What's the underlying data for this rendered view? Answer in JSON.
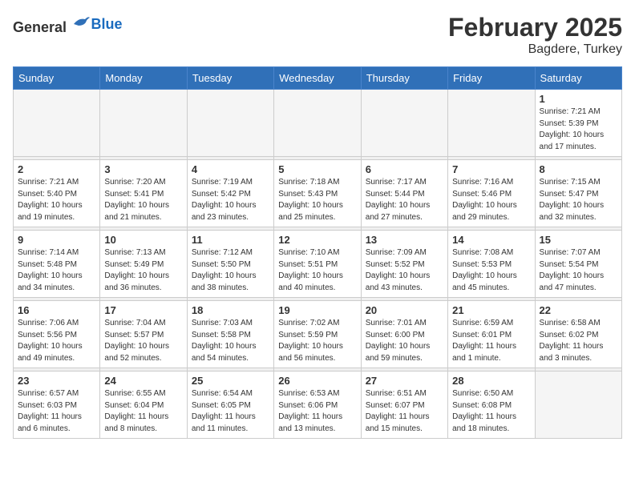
{
  "header": {
    "logo_general": "General",
    "logo_blue": "Blue",
    "month": "February 2025",
    "location": "Bagdere, Turkey"
  },
  "weekdays": [
    "Sunday",
    "Monday",
    "Tuesday",
    "Wednesday",
    "Thursday",
    "Friday",
    "Saturday"
  ],
  "weeks": [
    [
      {
        "day": "",
        "info": ""
      },
      {
        "day": "",
        "info": ""
      },
      {
        "day": "",
        "info": ""
      },
      {
        "day": "",
        "info": ""
      },
      {
        "day": "",
        "info": ""
      },
      {
        "day": "",
        "info": ""
      },
      {
        "day": "1",
        "info": "Sunrise: 7:21 AM\nSunset: 5:39 PM\nDaylight: 10 hours\nand 17 minutes."
      }
    ],
    [
      {
        "day": "2",
        "info": "Sunrise: 7:21 AM\nSunset: 5:40 PM\nDaylight: 10 hours\nand 19 minutes."
      },
      {
        "day": "3",
        "info": "Sunrise: 7:20 AM\nSunset: 5:41 PM\nDaylight: 10 hours\nand 21 minutes."
      },
      {
        "day": "4",
        "info": "Sunrise: 7:19 AM\nSunset: 5:42 PM\nDaylight: 10 hours\nand 23 minutes."
      },
      {
        "day": "5",
        "info": "Sunrise: 7:18 AM\nSunset: 5:43 PM\nDaylight: 10 hours\nand 25 minutes."
      },
      {
        "day": "6",
        "info": "Sunrise: 7:17 AM\nSunset: 5:44 PM\nDaylight: 10 hours\nand 27 minutes."
      },
      {
        "day": "7",
        "info": "Sunrise: 7:16 AM\nSunset: 5:46 PM\nDaylight: 10 hours\nand 29 minutes."
      },
      {
        "day": "8",
        "info": "Sunrise: 7:15 AM\nSunset: 5:47 PM\nDaylight: 10 hours\nand 32 minutes."
      }
    ],
    [
      {
        "day": "9",
        "info": "Sunrise: 7:14 AM\nSunset: 5:48 PM\nDaylight: 10 hours\nand 34 minutes."
      },
      {
        "day": "10",
        "info": "Sunrise: 7:13 AM\nSunset: 5:49 PM\nDaylight: 10 hours\nand 36 minutes."
      },
      {
        "day": "11",
        "info": "Sunrise: 7:12 AM\nSunset: 5:50 PM\nDaylight: 10 hours\nand 38 minutes."
      },
      {
        "day": "12",
        "info": "Sunrise: 7:10 AM\nSunset: 5:51 PM\nDaylight: 10 hours\nand 40 minutes."
      },
      {
        "day": "13",
        "info": "Sunrise: 7:09 AM\nSunset: 5:52 PM\nDaylight: 10 hours\nand 43 minutes."
      },
      {
        "day": "14",
        "info": "Sunrise: 7:08 AM\nSunset: 5:53 PM\nDaylight: 10 hours\nand 45 minutes."
      },
      {
        "day": "15",
        "info": "Sunrise: 7:07 AM\nSunset: 5:54 PM\nDaylight: 10 hours\nand 47 minutes."
      }
    ],
    [
      {
        "day": "16",
        "info": "Sunrise: 7:06 AM\nSunset: 5:56 PM\nDaylight: 10 hours\nand 49 minutes."
      },
      {
        "day": "17",
        "info": "Sunrise: 7:04 AM\nSunset: 5:57 PM\nDaylight: 10 hours\nand 52 minutes."
      },
      {
        "day": "18",
        "info": "Sunrise: 7:03 AM\nSunset: 5:58 PM\nDaylight: 10 hours\nand 54 minutes."
      },
      {
        "day": "19",
        "info": "Sunrise: 7:02 AM\nSunset: 5:59 PM\nDaylight: 10 hours\nand 56 minutes."
      },
      {
        "day": "20",
        "info": "Sunrise: 7:01 AM\nSunset: 6:00 PM\nDaylight: 10 hours\nand 59 minutes."
      },
      {
        "day": "21",
        "info": "Sunrise: 6:59 AM\nSunset: 6:01 PM\nDaylight: 11 hours\nand 1 minute."
      },
      {
        "day": "22",
        "info": "Sunrise: 6:58 AM\nSunset: 6:02 PM\nDaylight: 11 hours\nand 3 minutes."
      }
    ],
    [
      {
        "day": "23",
        "info": "Sunrise: 6:57 AM\nSunset: 6:03 PM\nDaylight: 11 hours\nand 6 minutes."
      },
      {
        "day": "24",
        "info": "Sunrise: 6:55 AM\nSunset: 6:04 PM\nDaylight: 11 hours\nand 8 minutes."
      },
      {
        "day": "25",
        "info": "Sunrise: 6:54 AM\nSunset: 6:05 PM\nDaylight: 11 hours\nand 11 minutes."
      },
      {
        "day": "26",
        "info": "Sunrise: 6:53 AM\nSunset: 6:06 PM\nDaylight: 11 hours\nand 13 minutes."
      },
      {
        "day": "27",
        "info": "Sunrise: 6:51 AM\nSunset: 6:07 PM\nDaylight: 11 hours\nand 15 minutes."
      },
      {
        "day": "28",
        "info": "Sunrise: 6:50 AM\nSunset: 6:08 PM\nDaylight: 11 hours\nand 18 minutes."
      },
      {
        "day": "",
        "info": ""
      }
    ]
  ]
}
